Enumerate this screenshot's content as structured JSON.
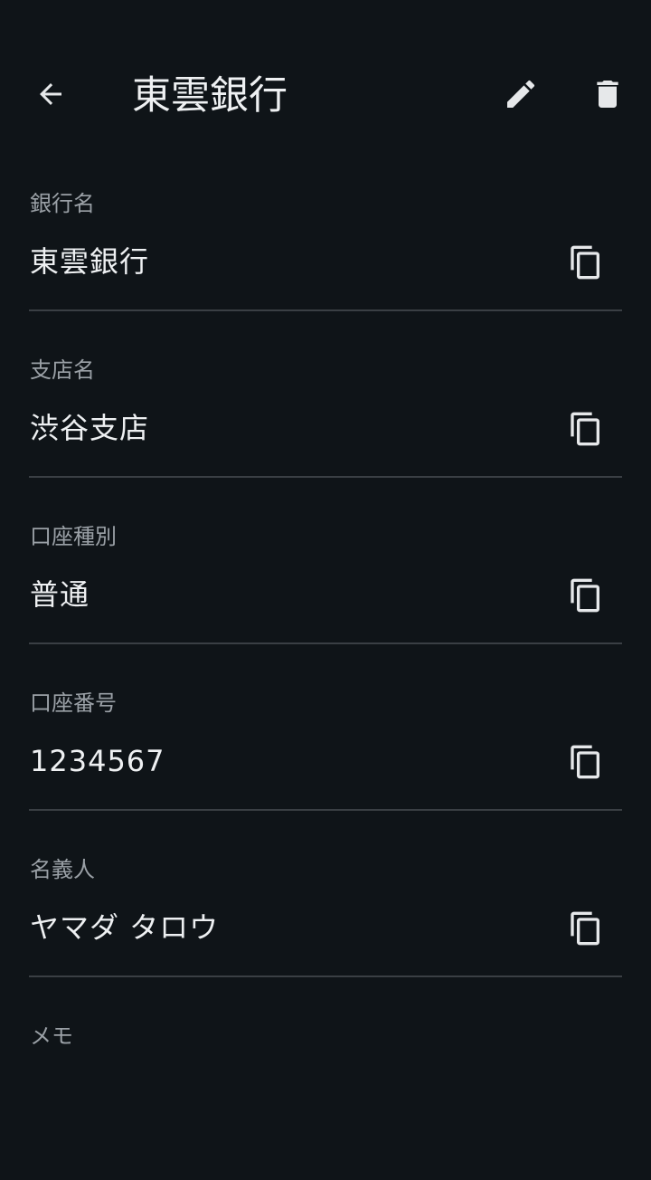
{
  "header": {
    "title": "東雲銀行",
    "back_icon": "arrow-left-icon",
    "edit_icon": "pencil-icon",
    "delete_icon": "trash-icon"
  },
  "fields": [
    {
      "label": "銀行名",
      "value": "東雲銀行"
    },
    {
      "label": "支店名",
      "value": "渋谷支店"
    },
    {
      "label": "口座種別",
      "value": "普通"
    },
    {
      "label": "口座番号",
      "value": "1234567"
    },
    {
      "label": "名義人",
      "value": "ヤマダ タロウ"
    },
    {
      "label": "メモ",
      "value": ""
    }
  ],
  "icons": {
    "copy": "copy-icon"
  },
  "colors": {
    "background": "#0f1418",
    "text": "#eef0f2",
    "label": "#9aa0a6",
    "divider": "#3a3f44",
    "icon": "#e6e8ea"
  }
}
